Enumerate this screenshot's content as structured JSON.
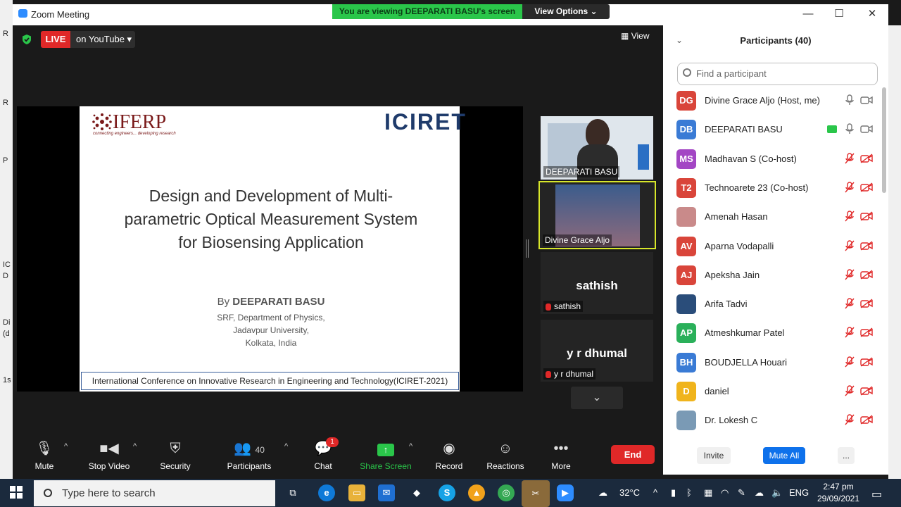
{
  "window": {
    "title": "Zoom Meeting",
    "minimize": "—",
    "maximize": "☐",
    "close": "✕"
  },
  "banner": {
    "viewing": "You are viewing DEEPARATI BASU's screen",
    "options": "View Options"
  },
  "live": {
    "label": "LIVE",
    "platform": "on YouTube"
  },
  "view_label": "View",
  "slide": {
    "logo_left": "IFERP",
    "logo_left_tagline": "connecting engineers... developing research",
    "logo_right": "ICIRET",
    "title_lines": [
      "Design and Development of Multi-",
      "parametric Optical Measurement System",
      "for Biosensing Application"
    ],
    "by_prefix": "By",
    "author": "DEEPARATI BASU",
    "affiliation": [
      "SRF, Department of Physics,",
      "Jadavpur University,",
      "Kolkata, India"
    ],
    "footer": "International Conference on Innovative Research in Engineering and Technology(ICIRET-2021)"
  },
  "gallery": [
    {
      "name": "DEEPARATI BASU",
      "type": "video"
    },
    {
      "name": "Divine Grace Aljo",
      "type": "video-active"
    },
    {
      "name": "sathish",
      "display": "sathish",
      "type": "name"
    },
    {
      "name": "y r dhumal",
      "display": "y r dhumal",
      "type": "name"
    }
  ],
  "toolbar": {
    "mute": "Mute",
    "stop_video": "Stop Video",
    "security": "Security",
    "participants": "Participants",
    "participants_count": "40",
    "chat": "Chat",
    "chat_badge": "1",
    "share_screen": "Share Screen",
    "record": "Record",
    "reactions": "Reactions",
    "more": "More",
    "end": "End"
  },
  "panel": {
    "title": "Participants (40)",
    "search_placeholder": "Find a participant",
    "participants": [
      {
        "initials": "DG",
        "name": "Divine Grace Aljo (Host, me)",
        "color": "#d9453a",
        "muted": false
      },
      {
        "initials": "DB",
        "name": "DEEPARATI BASU",
        "color": "#3a7bd5",
        "muted": false
      },
      {
        "initials": "MS",
        "name": "Madhavan S (Co-host)",
        "color": "#a346c4",
        "muted": true
      },
      {
        "initials": "T2",
        "name": "Technoarete 23 (Co-host)",
        "color": "#d9453a",
        "muted": true
      },
      {
        "initials": "",
        "name": "Amenah Hasan",
        "color": "#c98a8a",
        "muted": true
      },
      {
        "initials": "AV",
        "name": "Aparna Vodapalli",
        "color": "#d9453a",
        "muted": true
      },
      {
        "initials": "AJ",
        "name": "Apeksha Jain",
        "color": "#d9453a",
        "muted": true
      },
      {
        "initials": "",
        "name": "Arifa Tadvi",
        "color": "#2a4d7a",
        "muted": true
      },
      {
        "initials": "AP",
        "name": "Atmeshkumar Patel",
        "color": "#2ab05a",
        "muted": true
      },
      {
        "initials": "BH",
        "name": "BOUDJELLA Houari",
        "color": "#3a7bd5",
        "muted": true
      },
      {
        "initials": "D",
        "name": "daniel",
        "color": "#f0b41c",
        "muted": true
      },
      {
        "initials": "",
        "name": "Dr. Lokesh C",
        "color": "#7a9ab5",
        "muted": true
      }
    ],
    "invite": "Invite",
    "mute_all": "Mute All",
    "more": "..."
  },
  "taskbar": {
    "search_placeholder": "Type here to search",
    "weather": "32°C",
    "language": "ENG",
    "time": "2:47 pm",
    "date": "29/09/2021"
  },
  "desktop_left_letters": [
    "R",
    "R",
    "R",
    "P",
    "IC",
    "D",
    "Di",
    "(d",
    "1s"
  ]
}
